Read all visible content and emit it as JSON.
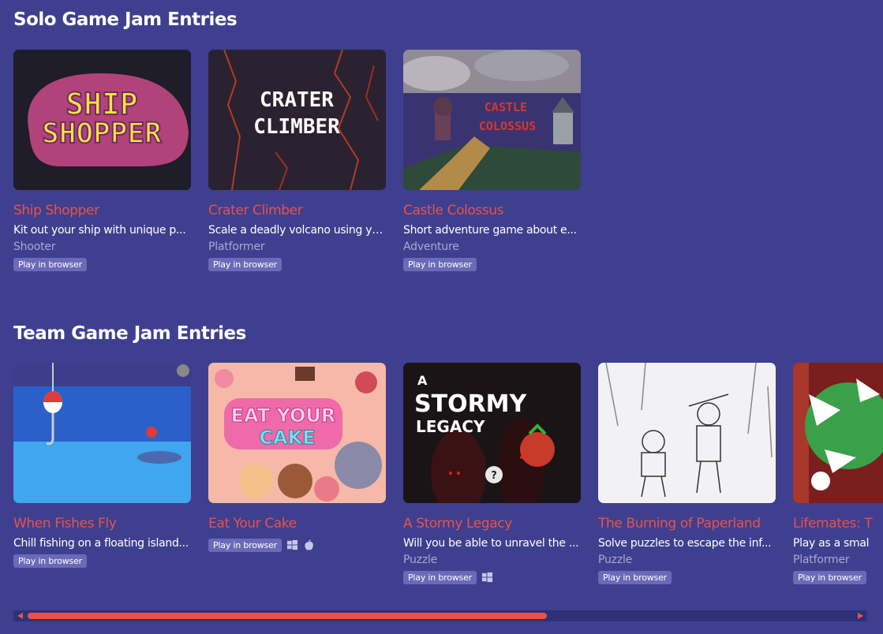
{
  "solo": {
    "heading": "Solo Game Jam Entries",
    "entries": [
      {
        "title": "Ship Shopper",
        "desc": "Kit out your ship with unique p...",
        "genre": "Shooter",
        "badge": "Play in browser"
      },
      {
        "title": "Crater Climber",
        "desc": "Scale a deadly volcano using yo...",
        "genre": "Platformer",
        "badge": "Play in browser"
      },
      {
        "title": "Castle Colossus",
        "desc": "Short adventure game about e...",
        "genre": "Adventure",
        "badge": "Play in browser"
      }
    ],
    "art": {
      "ship_line1": "SHIP",
      "ship_line2": "SHOPPER",
      "crater_line1": "CRATER",
      "crater_line2": "CLIMBER",
      "castle_line1": "CASTLE",
      "castle_line2": "COLOSSUS"
    }
  },
  "team": {
    "heading": "Team Game Jam Entries",
    "entries": [
      {
        "title": "When Fishes Fly",
        "desc": "Chill fishing on a floating island...",
        "badge": "Play in browser"
      },
      {
        "title": "Eat Your Cake",
        "badge": "Play in browser",
        "platforms": [
          "windows-icon",
          "apple-icon"
        ]
      },
      {
        "title": "A Stormy Legacy",
        "desc": "Will you be able to unravel the ...",
        "genre": "Puzzle",
        "badge": "Play in browser",
        "platforms": [
          "windows-icon"
        ]
      },
      {
        "title": "The Burning of Paperland",
        "desc": "Solve puzzles to escape the inf...",
        "genre": "Puzzle",
        "badge": "Play in browser"
      },
      {
        "title": "Lifemates: T",
        "desc": "Play as a smal",
        "genre": "Platformer",
        "badge": "Play in browser"
      }
    ],
    "art": {
      "cake_line1": "EAT YOUR",
      "cake_line2": "CAKE",
      "stormy_line1": "A",
      "stormy_line2": "STORMY",
      "stormy_line3": "LEGACY",
      "stormy_bubble": "?"
    }
  },
  "colors": {
    "accent": "#e9524a",
    "background": "#3e3f8f",
    "badge": "#6a6ab8",
    "muted": "#a9a9d4"
  }
}
